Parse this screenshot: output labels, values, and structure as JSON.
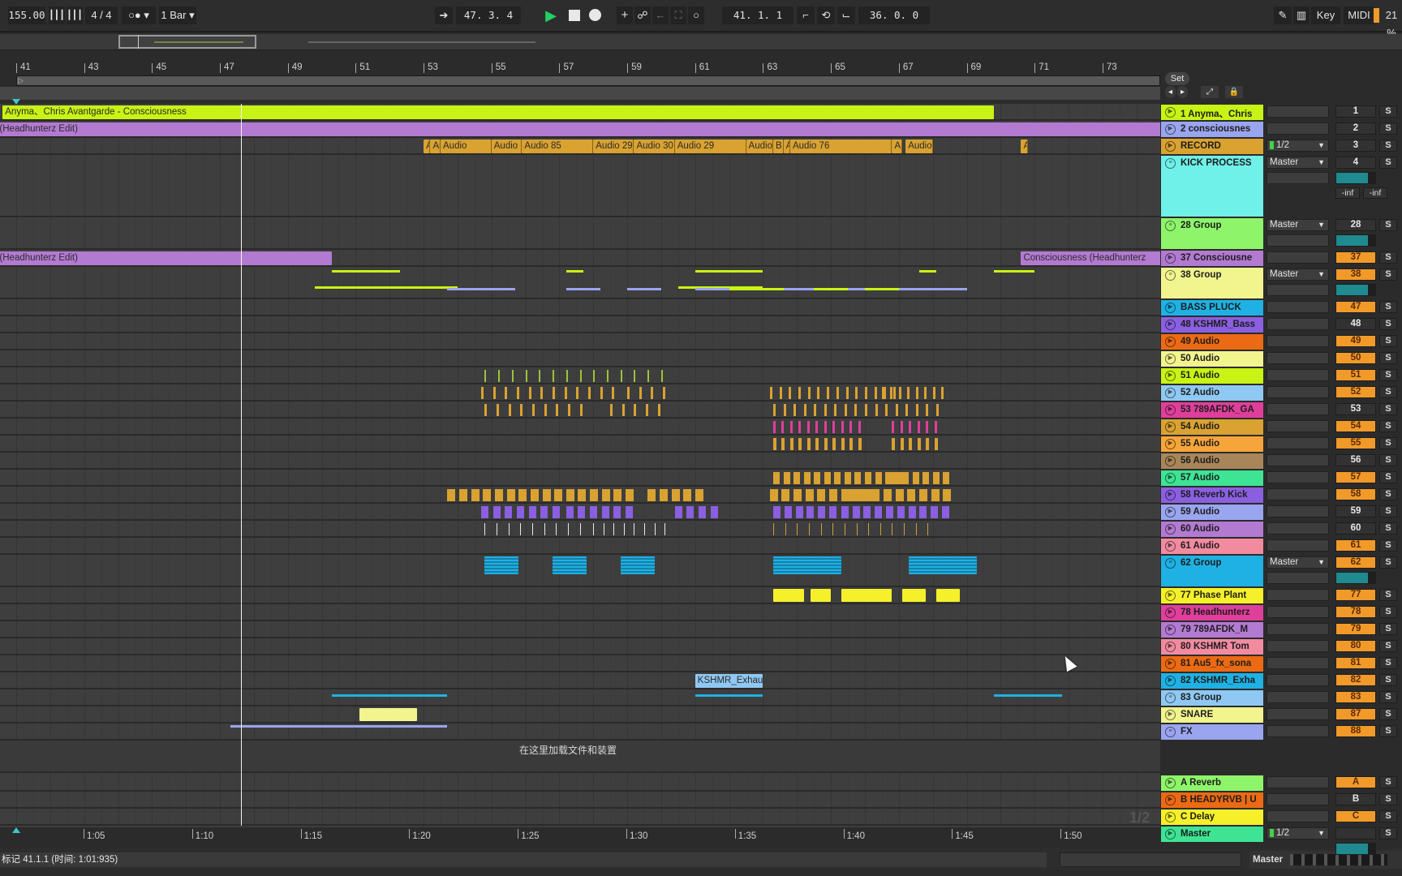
{
  "toolbar": {
    "tempo": "155.00",
    "time_signature": "4 / 4",
    "metronome_icon": "metronome-dots-icon",
    "quantize": "1 Bar",
    "follow_icon": "follow-arrow-icon",
    "song_position": "47.  3.  4",
    "play_icon": "play-icon",
    "stop_icon": "stop-icon",
    "record_icon": "record-icon",
    "add_icon": "plus-icon",
    "automation_icon": "automation-link-icon",
    "back_icon": "back-arrow-icon",
    "capture_icon": "capture-icon",
    "session_record_icon": "circle-icon",
    "loop_start": "41.  1.  1",
    "punch_in_icon": "punch-in-icon",
    "loop_icon": "loop-icon",
    "punch_out_icon": "punch-out-icon",
    "loop_length": "36.  0.  0",
    "draw_icon": "pencil-icon",
    "keyboard_icon": "piano-icon",
    "key_label": "Key",
    "midi_label": "MIDI",
    "cpu_load": "21 %"
  },
  "ruler": {
    "bars": [
      "41",
      "43",
      "45",
      "47",
      "49",
      "51",
      "53",
      "55",
      "57",
      "59",
      "61",
      "63",
      "65",
      "67",
      "69",
      "71",
      "73"
    ],
    "set_label": "Set"
  },
  "time_ruler": {
    "labels": [
      "1:05",
      "1:10",
      "1:15",
      "1:20",
      "1:25",
      "1:30",
      "1:35",
      "1:40",
      "1:45",
      "1:50"
    ]
  },
  "clips": {
    "anyma": "Anyma、Chris Avantgarde - Consciousness",
    "consciousness_edit": "sciousness (Headhunterz Edit)",
    "consciousness_edit_2": "sciousness (Headhunterz Edit)",
    "consciousness_right": "Consciousness (Headhunterz",
    "record_clips": [
      "A",
      "Au",
      "Audio",
      "Audio",
      "Audio 85",
      "Audio 29",
      "Audio 30",
      "Audio 29",
      "Audio",
      "B",
      "A",
      "Audio 76",
      "A",
      "Audio",
      "A"
    ],
    "kshmr_exhaust": "KSHMR_Exhau",
    "drop_hint": "在这里加载文件和装置"
  },
  "tracks": [
    {
      "name": "1 Anyma、Chris",
      "num": "1",
      "color": "#c8f314",
      "icon": "play",
      "route": "",
      "orange": false
    },
    {
      "name": "2 consciousnes",
      "num": "2",
      "color": "#9aa5ef",
      "icon": "play",
      "route": "",
      "orange": false
    },
    {
      "name": "RECORD",
      "num": "3",
      "color": "#d9a231",
      "icon": "play",
      "route": "1/2",
      "orange": false
    },
    {
      "name": "KICK PROCESS",
      "num": "4",
      "color": "#6ff0e8",
      "icon": "group",
      "route": "Master",
      "orange": false,
      "vol": "0",
      "inf": [
        "-inf",
        "-inf"
      ]
    },
    {
      "name": "28 Group",
      "num": "28",
      "color": "#8ef56a",
      "icon": "group",
      "route": "Master",
      "orange": false,
      "vol": "0"
    },
    {
      "name": "37 Consciousne",
      "num": "37",
      "color": "#b37ad1",
      "icon": "play",
      "route": "",
      "orange": true
    },
    {
      "name": "38 Group",
      "num": "38",
      "color": "#f2f48e",
      "icon": "group",
      "route": "Master",
      "orange": true,
      "vol": "0"
    },
    {
      "name": "BASS PLUCK",
      "num": "47",
      "color": "#1fb1e3",
      "icon": "play",
      "route": "",
      "orange": true
    },
    {
      "name": "48 KSHMR_Bass",
      "num": "48",
      "color": "#8a5fe0",
      "icon": "play",
      "route": "",
      "orange": false
    },
    {
      "name": "49 Audio",
      "num": "49",
      "color": "#ec6a14",
      "icon": "play",
      "route": "",
      "orange": true
    },
    {
      "name": "50 Audio",
      "num": "50",
      "color": "#f2f48e",
      "icon": "play",
      "route": "",
      "orange": true
    },
    {
      "name": "51 Audio",
      "num": "51",
      "color": "#c8f314",
      "icon": "play",
      "route": "",
      "orange": true
    },
    {
      "name": "52 Audio",
      "num": "52",
      "color": "#8fc8f2",
      "icon": "play",
      "route": "",
      "orange": true
    },
    {
      "name": "53 789AFDK_GA",
      "num": "53",
      "color": "#df3f9b",
      "icon": "play",
      "route": "",
      "orange": false
    },
    {
      "name": "54 Audio",
      "num": "54",
      "color": "#d9a231",
      "icon": "play",
      "route": "",
      "orange": true
    },
    {
      "name": "55 Audio",
      "num": "55",
      "color": "#f6a53a",
      "icon": "play",
      "route": "",
      "orange": true
    },
    {
      "name": "56 Audio",
      "num": "56",
      "color": "#a8865a",
      "icon": "play",
      "route": "",
      "orange": false
    },
    {
      "name": "57 Audio",
      "num": "57",
      "color": "#3ee394",
      "icon": "play",
      "route": "",
      "orange": true
    },
    {
      "name": "58 Reverb Kick",
      "num": "58",
      "color": "#8a5fe0",
      "icon": "play",
      "route": "",
      "orange": true
    },
    {
      "name": "59 Audio",
      "num": "59",
      "color": "#9aa5ef",
      "icon": "play",
      "route": "",
      "orange": false
    },
    {
      "name": "60 Audio",
      "num": "60",
      "color": "#b37ad1",
      "icon": "play",
      "route": "",
      "orange": false
    },
    {
      "name": "61 Audio",
      "num": "61",
      "color": "#f28aa0",
      "icon": "play",
      "route": "",
      "orange": true
    },
    {
      "name": "62 Group",
      "num": "62",
      "color": "#1fb1e3",
      "icon": "group",
      "route": "Master",
      "orange": true,
      "vol": "-2.0"
    },
    {
      "name": "77 Phase Plant",
      "num": "77",
      "color": "#f5f02a",
      "icon": "play",
      "route": "",
      "orange": true
    },
    {
      "name": "78 Headhunterz",
      "num": "78",
      "color": "#df3f9b",
      "icon": "play",
      "route": "",
      "orange": true
    },
    {
      "name": "79 789AFDK_M",
      "num": "79",
      "color": "#b37ad1",
      "icon": "play",
      "route": "",
      "orange": true
    },
    {
      "name": "80 KSHMR Tom",
      "num": "80",
      "color": "#f28aa0",
      "icon": "play",
      "route": "",
      "orange": true
    },
    {
      "name": "81 Au5_fx_sona",
      "num": "81",
      "color": "#ec6a14",
      "icon": "play",
      "route": "",
      "orange": true
    },
    {
      "name": "82 KSHMR_Exha",
      "num": "82",
      "color": "#1fb1e3",
      "icon": "play",
      "route": "",
      "orange": true
    },
    {
      "name": "83 Group",
      "num": "83",
      "color": "#8fc8f2",
      "icon": "group",
      "route": "",
      "orange": true
    },
    {
      "name": "SNARE",
      "num": "87",
      "color": "#f2f48e",
      "icon": "play",
      "route": "",
      "orange": true
    },
    {
      "name": "FX",
      "num": "88",
      "color": "#9aa5ef",
      "icon": "group",
      "route": "",
      "orange": true
    }
  ],
  "returns": [
    {
      "name": "A Reverb",
      "num": "A",
      "color": "#8ef56a",
      "orange": true
    },
    {
      "name": "B HEADYRVB | U",
      "num": "B",
      "color": "#ec6a14",
      "orange": false
    },
    {
      "name": "C Delay",
      "num": "C",
      "color": "#f5f02a",
      "orange": true
    }
  ],
  "master": {
    "name": "Master",
    "route": "1/2",
    "vol": "0",
    "color": "#3ee394"
  },
  "solo_label": "S",
  "pager": "1/2",
  "status": {
    "text": "标记 41.1.1 (时间:  1:01:935)",
    "master_label": "Master"
  }
}
